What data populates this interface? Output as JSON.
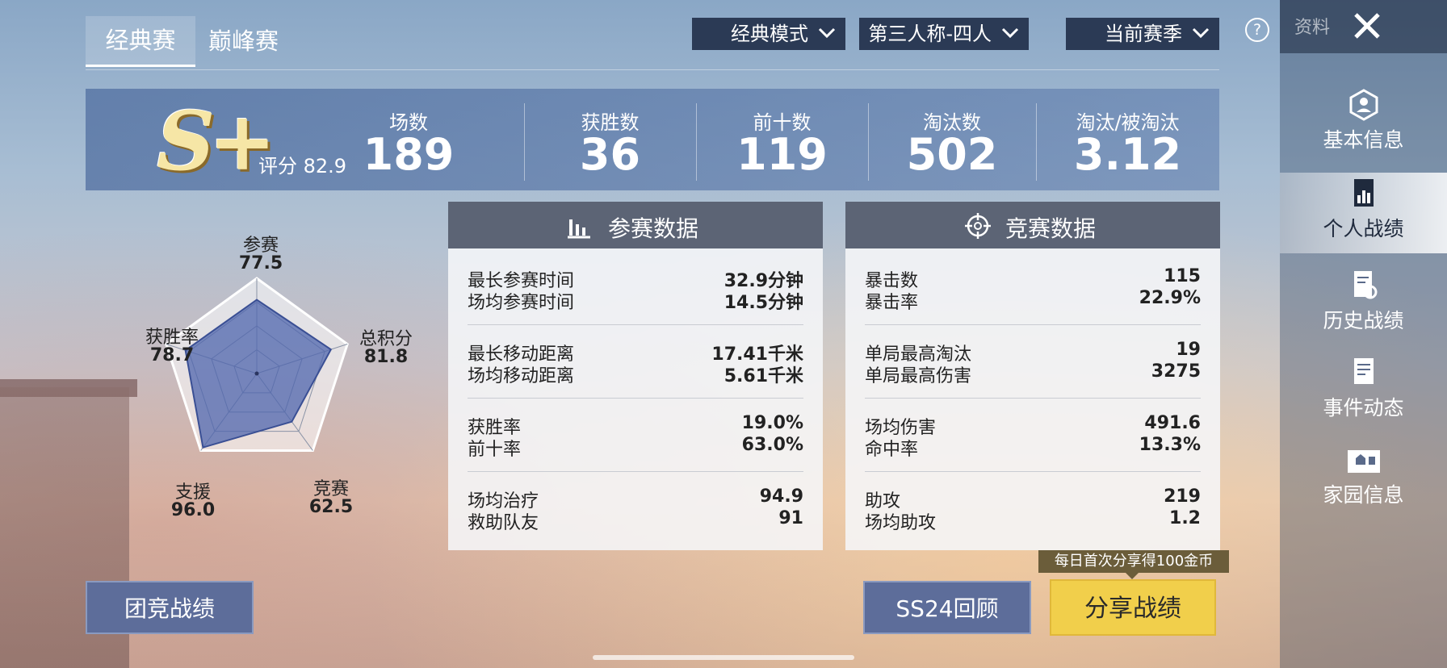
{
  "tabs": [
    {
      "label": "经典赛"
    },
    {
      "label": "巅峰赛"
    }
  ],
  "filters": {
    "mode": "经典模式",
    "perspective": "第三人称-四人",
    "season": "当前赛季"
  },
  "help_label": "?",
  "sidebar": {
    "header_label": "资料",
    "items": [
      {
        "label": "基本信息",
        "icon": "profile-icon"
      },
      {
        "label": "个人战绩",
        "icon": "stats-icon",
        "active": true
      },
      {
        "label": "历史战绩",
        "icon": "history-icon"
      },
      {
        "label": "事件动态",
        "icon": "events-icon"
      },
      {
        "label": "家园信息",
        "icon": "home-icon"
      }
    ]
  },
  "rank": {
    "tier": "S+",
    "score_label": "评分 82.9"
  },
  "summary": [
    {
      "label": "场数",
      "value": "189"
    },
    {
      "label": "获胜数",
      "value": "36"
    },
    {
      "label": "前十数",
      "value": "119"
    },
    {
      "label": "淘汰数",
      "value": "502"
    },
    {
      "label": "淘汰/被淘汰",
      "value": "3.12"
    }
  ],
  "radar": {
    "axes": [
      {
        "label": "参赛",
        "value": "77.5"
      },
      {
        "label": "总积分",
        "value": "81.8"
      },
      {
        "label": "竞赛",
        "value": "62.5"
      },
      {
        "label": "支援",
        "value": "96.0"
      },
      {
        "label": "获胜率",
        "value": "78.7"
      }
    ],
    "fill_color": "#4f65ad"
  },
  "participation": {
    "title": "参赛数据",
    "groups": [
      [
        {
          "k": "最长参赛时间",
          "v": "32.9分钟"
        },
        {
          "k": "场均参赛时间",
          "v": "14.5分钟"
        }
      ],
      [
        {
          "k": "最长移动距离",
          "v": "17.41千米"
        },
        {
          "k": "场均移动距离",
          "v": "5.61千米"
        }
      ],
      [
        {
          "k": "获胜率",
          "v": "19.0%"
        },
        {
          "k": "前十率",
          "v": "63.0%"
        }
      ],
      [
        {
          "k": "场均治疗",
          "v": "94.9"
        },
        {
          "k": "救助队友",
          "v": "91"
        }
      ]
    ]
  },
  "combat": {
    "title": "竞赛数据",
    "groups": [
      [
        {
          "k": "暴击数",
          "v": "115"
        },
        {
          "k": "暴击率",
          "v": "22.9%"
        }
      ],
      [
        {
          "k": "单局最高淘汰",
          "v": "19"
        },
        {
          "k": "单局最高伤害",
          "v": "3275"
        }
      ],
      [
        {
          "k": "场均伤害",
          "v": "491.6"
        },
        {
          "k": "命中率",
          "v": "13.3%"
        }
      ],
      [
        {
          "k": "助攻",
          "v": "219"
        },
        {
          "k": "场均助攻",
          "v": "1.2"
        }
      ]
    ]
  },
  "buttons": {
    "team": "团竞战绩",
    "review": "SS24回顾",
    "share": "分享战绩",
    "share_tip": "每日首次分享得100金币"
  }
}
